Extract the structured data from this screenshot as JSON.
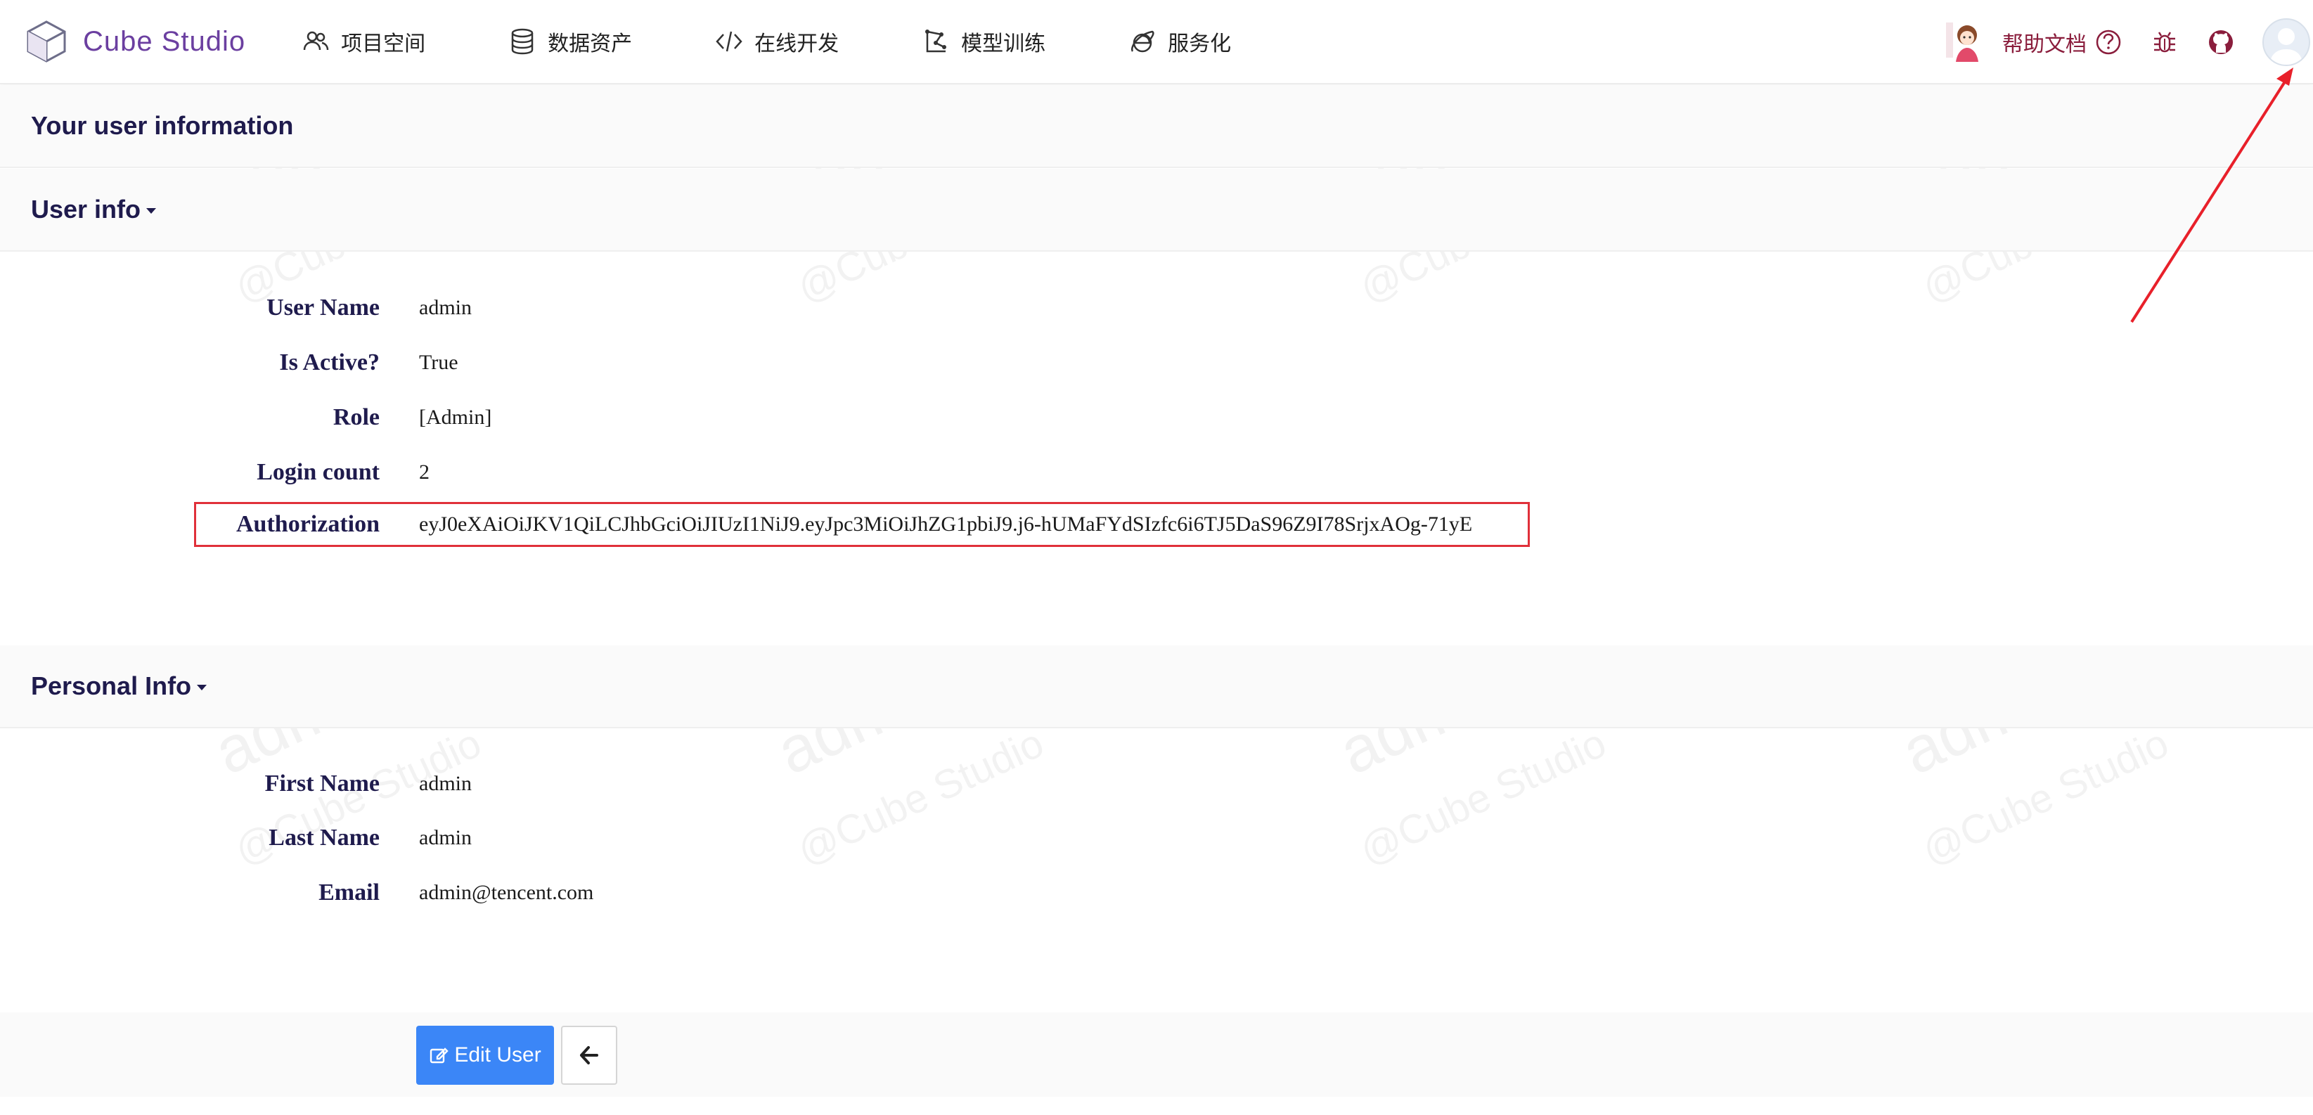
{
  "header": {
    "brand_name": "Cube Studio",
    "nav_items": [
      {
        "label": "项目空间",
        "icon": "users-icon"
      },
      {
        "label": "数据资产",
        "icon": "database-icon"
      },
      {
        "label": "在线开发",
        "icon": "code-icon"
      },
      {
        "label": "模型训练",
        "icon": "model-icon"
      },
      {
        "label": "服务化",
        "icon": "internet-explorer-icon"
      }
    ],
    "help_label": "帮助文档"
  },
  "page": {
    "title": "Your user information"
  },
  "user_info": {
    "section_title": "User info",
    "rows": [
      {
        "label": "User Name",
        "value": "admin"
      },
      {
        "label": "Is Active?",
        "value": "True"
      },
      {
        "label": "Role",
        "value": "[Admin]"
      },
      {
        "label": "Login count",
        "value": "2"
      },
      {
        "label": "Authorization",
        "value": "eyJ0eXAiOiJKV1QiLCJhbGciOiJIUzI1NiJ9.eyJpc3MiOiJhZG1pbiJ9.j6-hUMaFYdSIzfc6i6TJ5DaS96Z9I78SrjxAOg-71yE"
      }
    ]
  },
  "personal_info": {
    "section_title": "Personal Info",
    "rows": [
      {
        "label": "First Name",
        "value": "admin"
      },
      {
        "label": "Last Name",
        "value": "admin"
      },
      {
        "label": "Email",
        "value": "admin@tencent.com"
      }
    ]
  },
  "actions": {
    "edit_label": "Edit User"
  },
  "watermark": {
    "user": "admin",
    "brand": "@Cube Studio"
  },
  "colors": {
    "accent": "#3b86f7",
    "brand": "#6b3fa0",
    "highlight": "#e0303a"
  }
}
